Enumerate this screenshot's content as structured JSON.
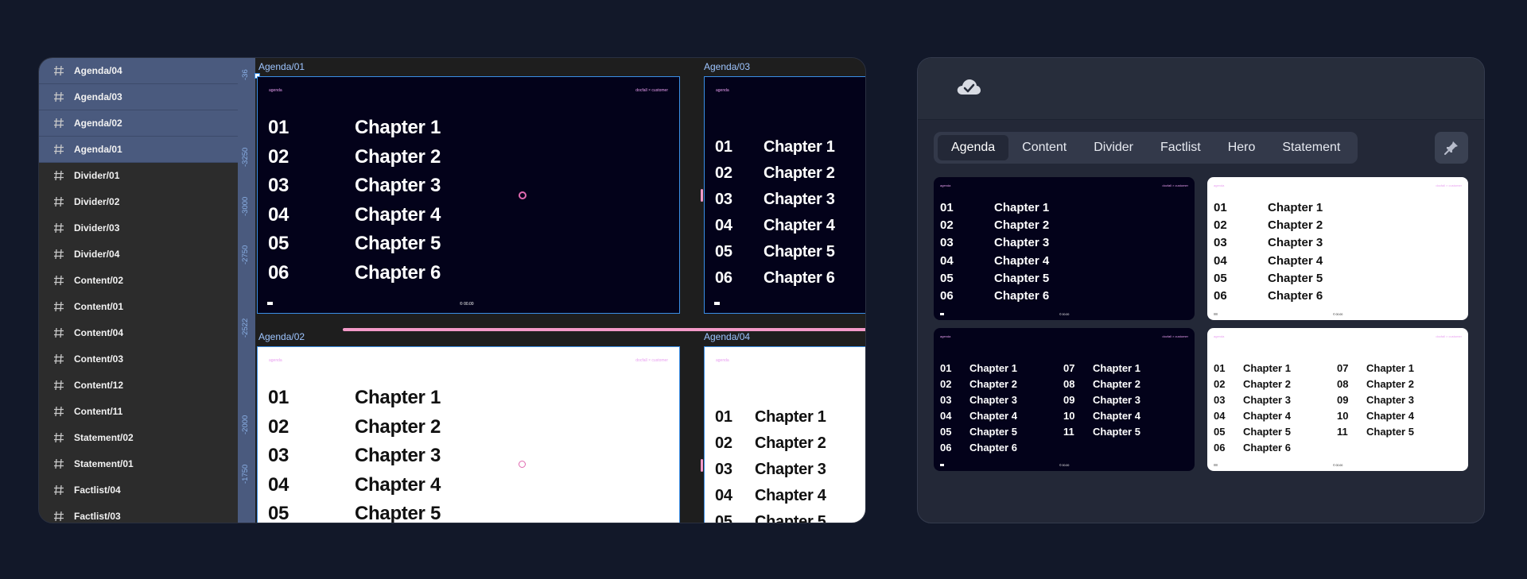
{
  "layers": [
    {
      "name": "Agenda/04",
      "selected": true
    },
    {
      "name": "Agenda/03",
      "selected": true
    },
    {
      "name": "Agenda/02",
      "selected": true
    },
    {
      "name": "Agenda/01",
      "selected": true
    },
    {
      "name": "Divider/01",
      "selected": false
    },
    {
      "name": "Divider/02",
      "selected": false
    },
    {
      "name": "Divider/03",
      "selected": false
    },
    {
      "name": "Divider/04",
      "selected": false
    },
    {
      "name": "Content/02",
      "selected": false
    },
    {
      "name": "Content/01",
      "selected": false
    },
    {
      "name": "Content/04",
      "selected": false
    },
    {
      "name": "Content/03",
      "selected": false
    },
    {
      "name": "Content/12",
      "selected": false
    },
    {
      "name": "Content/11",
      "selected": false
    },
    {
      "name": "Statement/02",
      "selected": false
    },
    {
      "name": "Statement/01",
      "selected": false
    },
    {
      "name": "Factlist/04",
      "selected": false
    },
    {
      "name": "Factlist/03",
      "selected": false
    }
  ],
  "ruler": {
    "ticks": [
      "-36",
      "-3250",
      "-3000",
      "-2750",
      "-2522",
      "-2000",
      "-1750"
    ]
  },
  "canvas": {
    "frames": {
      "agenda01": {
        "label": "Agenda/01",
        "tag": "agenda",
        "tag_right": "docfall × customer",
        "foot": "© 00.00"
      },
      "agenda03": {
        "label": "Agenda/03",
        "tag": "agenda"
      },
      "agenda02": {
        "label": "Agenda/02",
        "tag": "agenda",
        "tag_right": "docfall × customer"
      },
      "agenda04": {
        "label": "Agenda/04",
        "tag": "agenda"
      }
    },
    "rows": [
      {
        "num": "01",
        "title": "Chapter 1"
      },
      {
        "num": "02",
        "title": "Chapter 2"
      },
      {
        "num": "03",
        "title": "Chapter 3"
      },
      {
        "num": "04",
        "title": "Chapter 4"
      },
      {
        "num": "05",
        "title": "Chapter 5"
      },
      {
        "num": "06",
        "title": "Chapter 6"
      }
    ]
  },
  "plugin": {
    "tabs": [
      "Agenda",
      "Content",
      "Divider",
      "Factlist",
      "Hero",
      "Statement"
    ],
    "active_tab": "Agenda",
    "cards": {
      "tag": "agenda",
      "tag_right": "docfall × customer",
      "foot": "© 00.00",
      "single_rows": [
        {
          "num": "01",
          "title": "Chapter 1"
        },
        {
          "num": "02",
          "title": "Chapter 2"
        },
        {
          "num": "03",
          "title": "Chapter 3"
        },
        {
          "num": "04",
          "title": "Chapter 4"
        },
        {
          "num": "05",
          "title": "Chapter 5"
        },
        {
          "num": "06",
          "title": "Chapter 6"
        }
      ],
      "col_a": [
        {
          "num": "01",
          "title": "Chapter 1"
        },
        {
          "num": "02",
          "title": "Chapter 2"
        },
        {
          "num": "03",
          "title": "Chapter 3"
        },
        {
          "num": "04",
          "title": "Chapter 4"
        },
        {
          "num": "05",
          "title": "Chapter 5"
        },
        {
          "num": "06",
          "title": "Chapter 6"
        }
      ],
      "col_b": [
        {
          "num": "07",
          "title": "Chapter 1"
        },
        {
          "num": "08",
          "title": "Chapter 2"
        },
        {
          "num": "09",
          "title": "Chapter 3"
        },
        {
          "num": "10",
          "title": "Chapter 4"
        },
        {
          "num": "11",
          "title": "Chapter 5"
        }
      ]
    },
    "colors": {
      "accent_pink": "#f39ac8",
      "selection_blue": "#3a8ee6",
      "slide_dark": "#03021a"
    }
  }
}
